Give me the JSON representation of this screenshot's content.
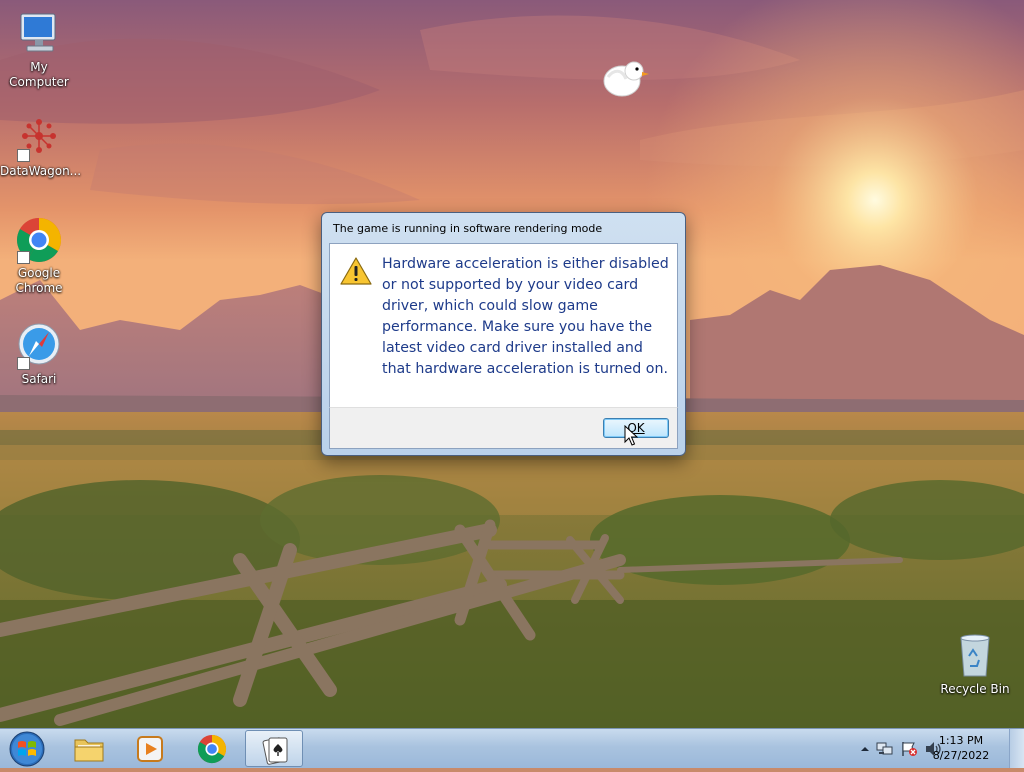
{
  "desktop": {
    "icons": [
      {
        "label": "My Computer",
        "icon": "computer-icon",
        "shortcut": false
      },
      {
        "label": "DataWagon...",
        "icon": "datawagon-icon",
        "shortcut": true
      },
      {
        "label": "Google Chrome",
        "icon": "chrome-icon",
        "shortcut": true
      },
      {
        "label": "Safari",
        "icon": "safari-icon",
        "shortcut": true
      },
      {
        "label": "Recycle Bin",
        "icon": "recycle-bin-icon",
        "shortcut": false
      }
    ]
  },
  "dialog": {
    "title": "The game is running in software rendering mode",
    "message": "Hardware acceleration is either disabled or not supported by your video card driver, which could slow game performance. Make sure you have the latest video card driver installed and that hardware acceleration is turned on.",
    "icon": "warning-icon",
    "ok_label": "OK"
  },
  "taskbar": {
    "items": [
      {
        "name": "start",
        "icon": "windows-start-icon"
      },
      {
        "name": "file-explorer",
        "icon": "folder-icon"
      },
      {
        "name": "media-player",
        "icon": "media-player-icon"
      },
      {
        "name": "chrome",
        "icon": "chrome-icon"
      },
      {
        "name": "solitaire",
        "icon": "cards-icon",
        "active": true
      }
    ],
    "tray": {
      "icons": [
        "show-hidden-icons-chevron",
        "network-icon",
        "action-center-flag-icon",
        "volume-icon"
      ],
      "time": "1:13 PM",
      "date": "8/27/2022"
    }
  },
  "colors": {
    "dialog_text": "#1e3b8a",
    "taskbar": "#a9c3df",
    "sky_top": "#8a5a7a",
    "sunset": "#ffd79a"
  }
}
